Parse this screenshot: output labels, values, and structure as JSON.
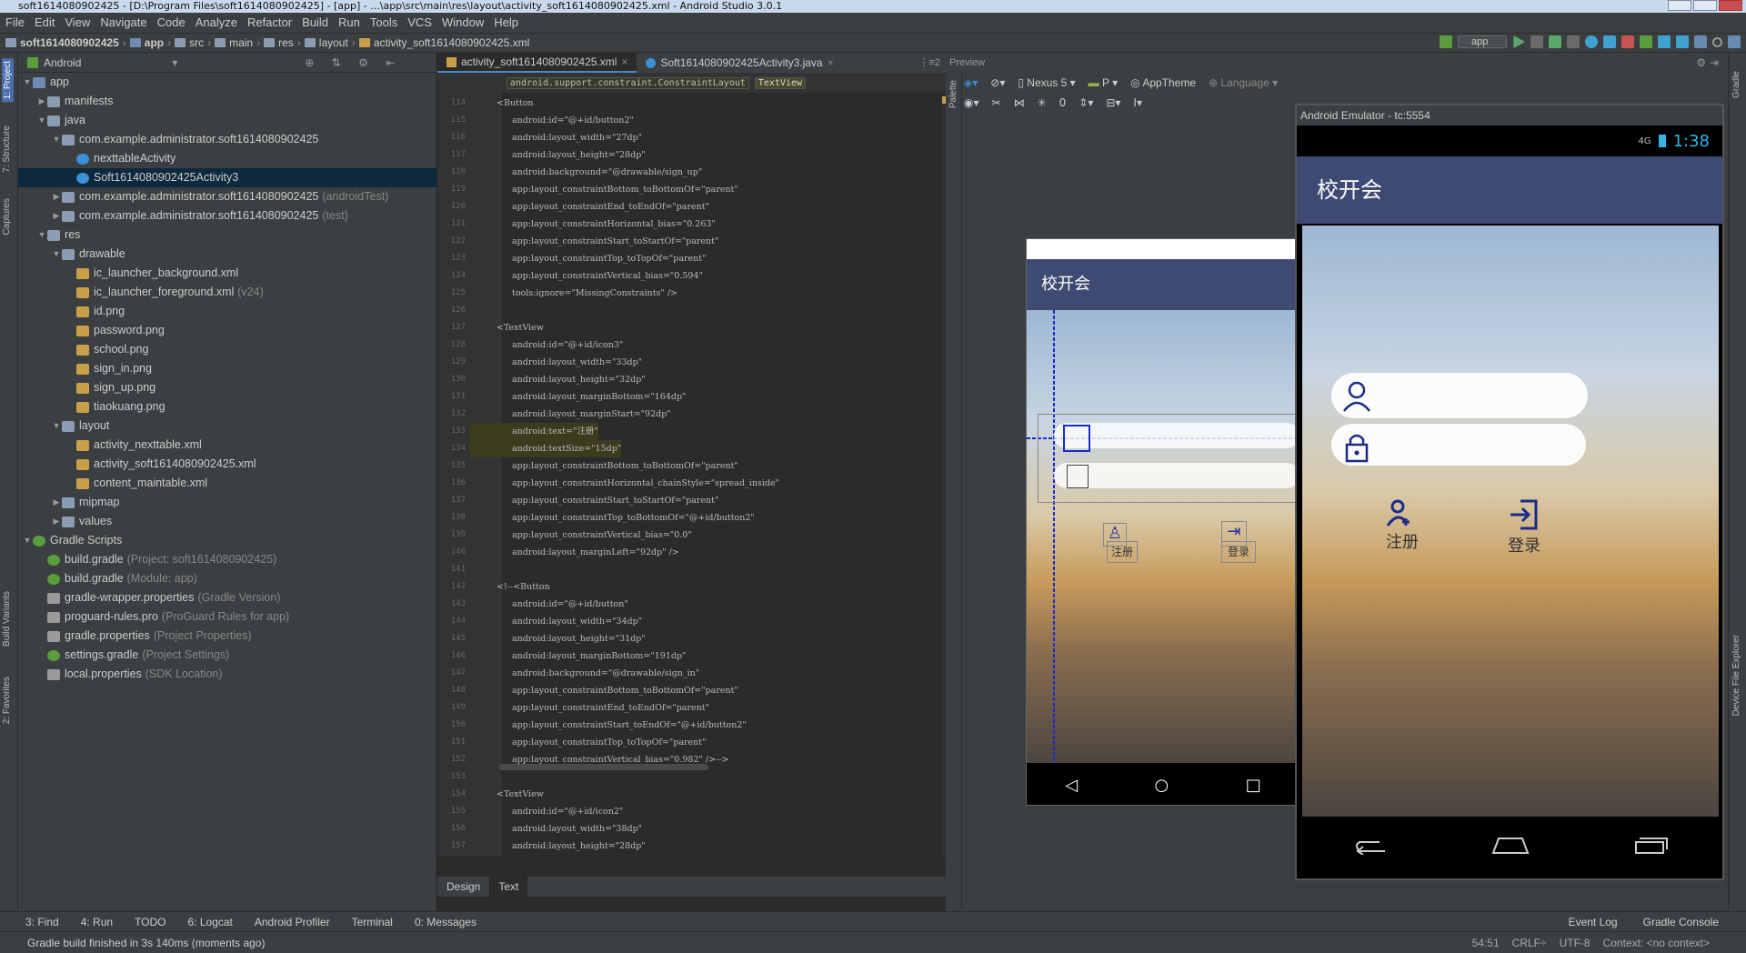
{
  "window": {
    "title": "soft1614080902425 - [D:\\Program Files\\soft1614080902425] - [app] - ...\\app\\src\\main\\res\\layout\\activity_soft1614080902425.xml - Android Studio 3.0.1"
  },
  "menu": [
    "File",
    "Edit",
    "View",
    "Navigate",
    "Code",
    "Analyze",
    "Refactor",
    "Build",
    "Run",
    "Tools",
    "VCS",
    "Window",
    "Help"
  ],
  "breadcrumbs": [
    "soft1614080902425",
    "app",
    "src",
    "main",
    "res",
    "layout",
    "activity_soft1614080902425.xml"
  ],
  "run_config": "app",
  "left_tabs": {
    "project": "1: Project",
    "structure": "7: Structure",
    "captures": "Captures",
    "build_variants": "Build Variants",
    "favorites": "2: Favorites"
  },
  "project_panel": {
    "view_mode": "Android",
    "tree": [
      {
        "label": "app",
        "extra": "",
        "icon": "module",
        "arrow": "▼",
        "sel": false
      },
      {
        "label": "manifests",
        "extra": "",
        "icon": "folder",
        "arrow": "▶",
        "sel": false
      },
      {
        "label": "java",
        "extra": "",
        "icon": "folder",
        "arrow": "▼",
        "sel": false
      },
      {
        "label": "com.example.administrator.soft1614080902425",
        "extra": "",
        "icon": "package",
        "arrow": "▼",
        "sel": false
      },
      {
        "label": "nexttableActivity",
        "extra": "",
        "icon": "class",
        "arrow": "",
        "sel": false
      },
      {
        "label": "Soft1614080902425Activity3",
        "extra": "",
        "icon": "class",
        "arrow": "",
        "sel": true
      },
      {
        "label": "com.example.administrator.soft1614080902425",
        "extra": "(androidTest)",
        "icon": "package",
        "arrow": "▶",
        "sel": false
      },
      {
        "label": "com.example.administrator.soft1614080902425",
        "extra": "(test)",
        "icon": "package",
        "arrow": "▶",
        "sel": false
      },
      {
        "label": "res",
        "extra": "",
        "icon": "folder",
        "arrow": "▼",
        "sel": false
      },
      {
        "label": "drawable",
        "extra": "",
        "icon": "folder",
        "arrow": "▼",
        "sel": false
      },
      {
        "label": "ic_launcher_background.xml",
        "extra": "",
        "icon": "xml",
        "arrow": "",
        "sel": false
      },
      {
        "label": "ic_launcher_foreground.xml",
        "extra": "(v24)",
        "icon": "xml",
        "arrow": "",
        "sel": false
      },
      {
        "label": "id.png",
        "extra": "",
        "icon": "image",
        "arrow": "",
        "sel": false
      },
      {
        "label": "password.png",
        "extra": "",
        "icon": "image",
        "arrow": "",
        "sel": false
      },
      {
        "label": "school.png",
        "extra": "",
        "icon": "image",
        "arrow": "",
        "sel": false
      },
      {
        "label": "sign_in.png",
        "extra": "",
        "icon": "image",
        "arrow": "",
        "sel": false
      },
      {
        "label": "sign_up.png",
        "extra": "",
        "icon": "image",
        "arrow": "",
        "sel": false
      },
      {
        "label": "tiaokuang.png",
        "extra": "",
        "icon": "image",
        "arrow": "",
        "sel": false
      },
      {
        "label": "layout",
        "extra": "",
        "icon": "folder",
        "arrow": "▼",
        "sel": false
      },
      {
        "label": "activity_nexttable.xml",
        "extra": "",
        "icon": "xml",
        "arrow": "",
        "sel": false
      },
      {
        "label": "activity_soft1614080902425.xml",
        "extra": "",
        "icon": "xml",
        "arrow": "",
        "sel": false
      },
      {
        "label": "content_maintable.xml",
        "extra": "",
        "icon": "xml",
        "arrow": "",
        "sel": false
      },
      {
        "label": "mipmap",
        "extra": "",
        "icon": "folder",
        "arrow": "▶",
        "sel": false
      },
      {
        "label": "values",
        "extra": "",
        "icon": "folder",
        "arrow": "▶",
        "sel": false
      },
      {
        "label": "Gradle Scripts",
        "extra": "",
        "icon": "gradle",
        "arrow": "▼",
        "sel": false
      },
      {
        "label": "build.gradle",
        "extra": "(Project: soft1614080902425)",
        "icon": "gradle",
        "arrow": "",
        "sel": false
      },
      {
        "label": "build.gradle",
        "extra": "(Module: app)",
        "icon": "gradle",
        "arrow": "",
        "sel": false
      },
      {
        "label": "gradle-wrapper.properties",
        "extra": "(Gradle Version)",
        "icon": "props",
        "arrow": "",
        "sel": false
      },
      {
        "label": "proguard-rules.pro",
        "extra": "(ProGuard Rules for app)",
        "icon": "props",
        "arrow": "",
        "sel": false
      },
      {
        "label": "gradle.properties",
        "extra": "(Project Properties)",
        "icon": "props",
        "arrow": "",
        "sel": false
      },
      {
        "label": "settings.gradle",
        "extra": "(Project Settings)",
        "icon": "gradle",
        "arrow": "",
        "sel": false
      },
      {
        "label": "local.properties",
        "extra": "(SDK Location)",
        "icon": "props",
        "arrow": "",
        "sel": false
      }
    ]
  },
  "editor": {
    "tabs": [
      "activity_soft1614080902425.xml",
      "Soft1614080902425Activity3.java"
    ],
    "breadcrumb": [
      "android.support.constraint.ConstraintLayout",
      "TextView"
    ],
    "mode_tabs": [
      "Design",
      "Text"
    ],
    "lines": [
      {
        "n": "114",
        "t": "<Button",
        "k": "tag"
      },
      {
        "n": "115",
        "t": "android:id=\"@+id/button2\"",
        "k": "attr"
      },
      {
        "n": "116",
        "t": "android:layout_width=\"27dp\"",
        "k": "attr"
      },
      {
        "n": "117",
        "t": "android:layout_height=\"28dp\"",
        "k": "attr"
      },
      {
        "n": "118",
        "t": "android:background=\"@drawable/sign_up\"",
        "k": "attr"
      },
      {
        "n": "119",
        "t": "app:layout_constraintBottom_toBottomOf=\"parent\"",
        "k": "attr"
      },
      {
        "n": "120",
        "t": "app:layout_constraintEnd_toEndOf=\"parent\"",
        "k": "attr"
      },
      {
        "n": "121",
        "t": "app:layout_constraintHorizontal_bias=\"0.263\"",
        "k": "attr"
      },
      {
        "n": "122",
        "t": "app:layout_constraintStart_toStartOf=\"parent\"",
        "k": "attr"
      },
      {
        "n": "123",
        "t": "app:layout_constraintTop_toTopOf=\"parent\"",
        "k": "attr"
      },
      {
        "n": "124",
        "t": "app:layout_constraintVertical_bias=\"0.594\"",
        "k": "attr"
      },
      {
        "n": "125",
        "t": "tools:ignore=\"MissingConstraints\" />",
        "k": "attr"
      },
      {
        "n": "126",
        "t": "",
        "k": "blank"
      },
      {
        "n": "127",
        "t": "<TextView",
        "k": "tag"
      },
      {
        "n": "128",
        "t": "android:id=\"@+id/icon3\"",
        "k": "attr"
      },
      {
        "n": "129",
        "t": "android:layout_width=\"33dp\"",
        "k": "attr"
      },
      {
        "n": "130",
        "t": "android:layout_height=\"32dp\"",
        "k": "attr"
      },
      {
        "n": "131",
        "t": "android:layout_marginBottom=\"164dp\"",
        "k": "attr"
      },
      {
        "n": "132",
        "t": "android:layout_marginStart=\"92dp\"",
        "k": "attr"
      },
      {
        "n": "133",
        "t": "android:text=\"注册\"",
        "k": "hl"
      },
      {
        "n": "134",
        "t": "android:textSize=\"15dp\"",
        "k": "hl"
      },
      {
        "n": "135",
        "t": "app:layout_constraintBottom_toBottomOf=\"parent\"",
        "k": "attr"
      },
      {
        "n": "136",
        "t": "app:layout_constraintHorizontal_chainStyle=\"spread_inside\"",
        "k": "attr"
      },
      {
        "n": "137",
        "t": "app:layout_constraintStart_toStartOf=\"parent\"",
        "k": "attr"
      },
      {
        "n": "138",
        "t": "app:layout_constraintTop_toBottomOf=\"@+id/button2\"",
        "k": "attr"
      },
      {
        "n": "139",
        "t": "app:layout_constraintVertical_bias=\"0.0\"",
        "k": "attr"
      },
      {
        "n": "140",
        "t": "android:layout_marginLeft=\"92dp\" />",
        "k": "attr"
      },
      {
        "n": "141",
        "t": "",
        "k": "blank"
      },
      {
        "n": "142",
        "t": "<!--<Button",
        "k": "comment"
      },
      {
        "n": "143",
        "t": "android:id=\"@+id/button\"",
        "k": "comment"
      },
      {
        "n": "144",
        "t": "android:layout_width=\"34dp\"",
        "k": "comment"
      },
      {
        "n": "145",
        "t": "android:layout_height=\"31dp\"",
        "k": "comment"
      },
      {
        "n": "146",
        "t": "android:layout_marginBottom=\"191dp\"",
        "k": "comment"
      },
      {
        "n": "147",
        "t": "android:background=\"@drawable/sign_in\"",
        "k": "comment"
      },
      {
        "n": "148",
        "t": "app:layout_constraintBottom_toBottomOf=\"parent\"",
        "k": "comment"
      },
      {
        "n": "149",
        "t": "app:layout_constraintEnd_toEndOf=\"parent\"",
        "k": "comment"
      },
      {
        "n": "150",
        "t": "app:layout_constraintStart_toEndOf=\"@+id/button2\"",
        "k": "comment"
      },
      {
        "n": "151",
        "t": "app:layout_constraintTop_toTopOf=\"parent\"",
        "k": "comment"
      },
      {
        "n": "152",
        "t": "app:layout_constraintVertical_bias=\"0.982\" />-->",
        "k": "comment"
      },
      {
        "n": "153",
        "t": "",
        "k": "blank"
      },
      {
        "n": "154",
        "t": "<TextView",
        "k": "tag"
      },
      {
        "n": "155",
        "t": "android:id=\"@+id/icon2\"",
        "k": "attr"
      },
      {
        "n": "156",
        "t": "android:layout_width=\"38dp\"",
        "k": "attr"
      },
      {
        "n": "157",
        "t": "android:layout_height=\"28dp\"",
        "k": "attr"
      }
    ]
  },
  "preview": {
    "label": "Preview",
    "device": "Nexus 5",
    "api": "P",
    "theme": "AppTheme",
    "language": "Language",
    "zoom": "0",
    "app_title": "校开会",
    "register": "注册",
    "login": "登录"
  },
  "emulator": {
    "title": "Android Emulator - tc:5554",
    "clock": "1:38",
    "signal": "4G",
    "app_title": "校开会",
    "register": "注册",
    "login": "登录"
  },
  "bottom_tools": [
    "3: Find",
    "4: Run",
    "TODO",
    "6: Logcat",
    "Android Profiler",
    "Terminal",
    "0: Messages"
  ],
  "bottom_tools_right": [
    "Event Log",
    "Gradle Console"
  ],
  "status": {
    "message": "Gradle build finished in 3s 140ms (moments ago)",
    "position": "54:51",
    "line_sep": "CRLF÷",
    "encoding": "UTF-8",
    "context": "Context: <no context>"
  },
  "colors": {
    "appbar": "#3f4a72",
    "ide_bg": "#2b2b2b",
    "panel": "#3c3f41",
    "select": "#0d293e",
    "blueprint": "#1a2bd1"
  }
}
